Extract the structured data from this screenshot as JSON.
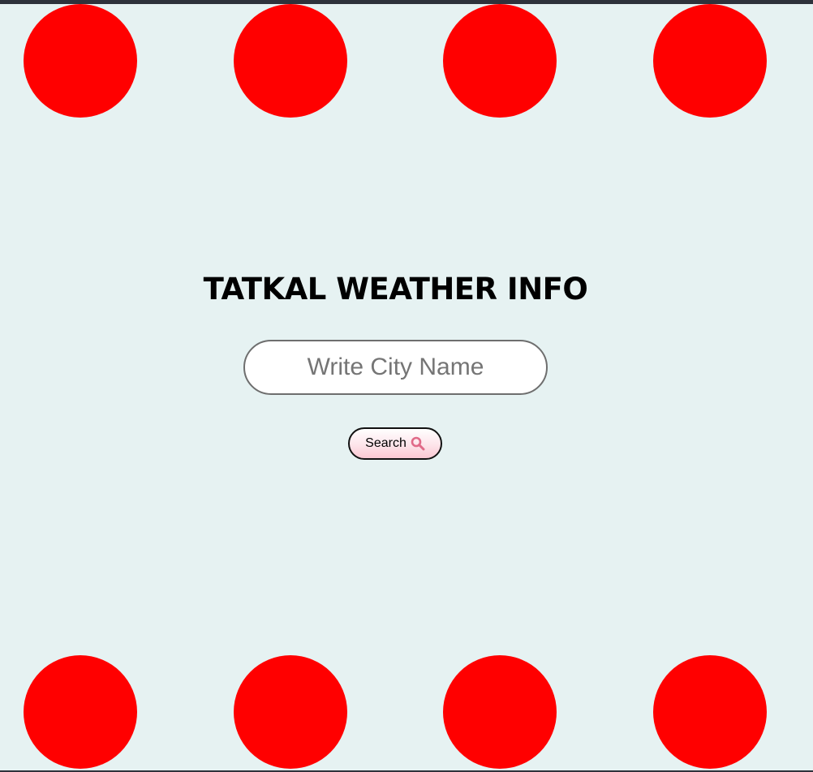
{
  "page": {
    "title": "TATKAL WEATHER INFO",
    "background_color": "#e6f2f2",
    "dot_color": "#ff0000"
  },
  "search": {
    "placeholder": "Write City Name",
    "value": "",
    "button_label": "Search",
    "button_icon": "search-icon",
    "icon_color": "#e06a88"
  }
}
